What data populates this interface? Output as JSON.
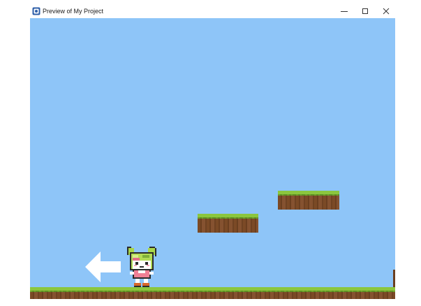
{
  "window": {
    "title": "Preview of My Project",
    "icon": "app-icon",
    "controls": {
      "minimize_icon": "minimize-icon",
      "maximize_icon": "maximize-icon",
      "close_icon": "close-icon"
    }
  },
  "game": {
    "sky_color": "#8ec5f8",
    "grass_color": "#8bc63e",
    "dirt_color": "#7a4a25",
    "elements": [
      "ground",
      "platform",
      "platform",
      "left-arrow-control",
      "player-character"
    ]
  }
}
